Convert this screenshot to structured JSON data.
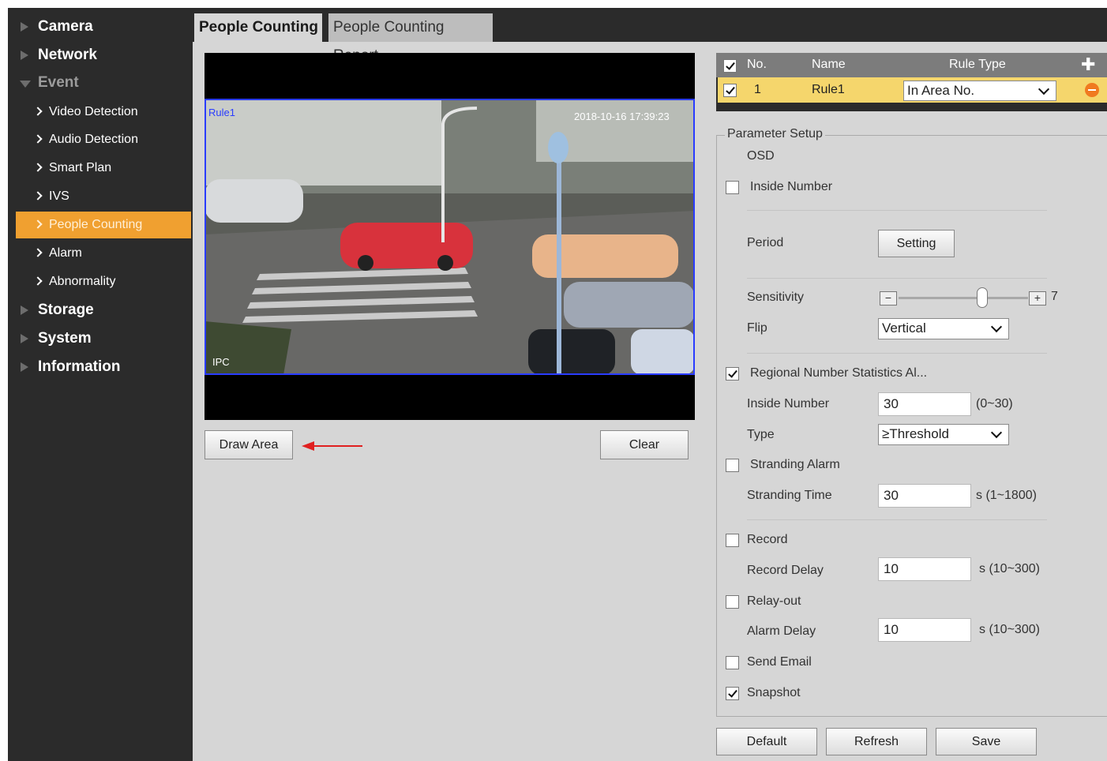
{
  "sidebar": {
    "top": [
      {
        "label": "Camera"
      },
      {
        "label": "Network"
      },
      {
        "label": "Event"
      },
      {
        "label": "Storage"
      },
      {
        "label": "System"
      },
      {
        "label": "Information"
      }
    ],
    "event_items": [
      {
        "label": "Video Detection"
      },
      {
        "label": "Audio Detection"
      },
      {
        "label": "Smart Plan"
      },
      {
        "label": "IVS"
      },
      {
        "label": "People Counting"
      },
      {
        "label": "Alarm"
      },
      {
        "label": "Abnormality"
      }
    ],
    "active_item": "People Counting"
  },
  "tabs": [
    {
      "label": "People Counting"
    },
    {
      "label": "People Counting Report"
    }
  ],
  "video": {
    "timestamp": "2018-10-16 17:39:23",
    "rule_label": "Rule1",
    "camera_label": "IPC"
  },
  "buttons": {
    "draw_area": "Draw Area",
    "clear": "Clear",
    "setting": "Setting",
    "default": "Default",
    "refresh": "Refresh",
    "save": "Save"
  },
  "rule_table": {
    "headers": {
      "no": "No.",
      "name": "Name",
      "rule_type": "Rule Type"
    },
    "rows": [
      {
        "no": "1",
        "name": "Rule1",
        "rule_type": "In Area No.",
        "checked": true
      }
    ]
  },
  "params": {
    "legend": "Parameter Setup",
    "osd": "OSD",
    "inside_number_osd": "Inside Number",
    "period": "Period",
    "sensitivity": "Sensitivity",
    "sensitivity_value": "7",
    "flip": "Flip",
    "flip_value": "Vertical",
    "regional_alarm": "Regional Number Statistics Al...",
    "inside_number": "Inside Number",
    "inside_number_value": "30",
    "inside_number_range": "(0~30)",
    "type": "Type",
    "type_value": "≥Threshold",
    "stranding_alarm": "Stranding Alarm",
    "stranding_time": "Stranding Time",
    "stranding_time_value": "30",
    "stranding_time_range": "s (1~1800)",
    "record": "Record",
    "record_delay": "Record Delay",
    "record_delay_value": "10",
    "record_delay_range": "s (10~300)",
    "relay_out": "Relay-out",
    "alarm_delay": "Alarm Delay",
    "alarm_delay_value": "10",
    "alarm_delay_range": "s (10~300)",
    "send_email": "Send Email",
    "snapshot": "Snapshot"
  },
  "colors": {
    "sidebar_bg": "#2b2b2b",
    "active": "#f0a030",
    "panel_bg": "#d6d6d6",
    "row_highlight": "#f5d66c",
    "arrow": "#e02020"
  }
}
